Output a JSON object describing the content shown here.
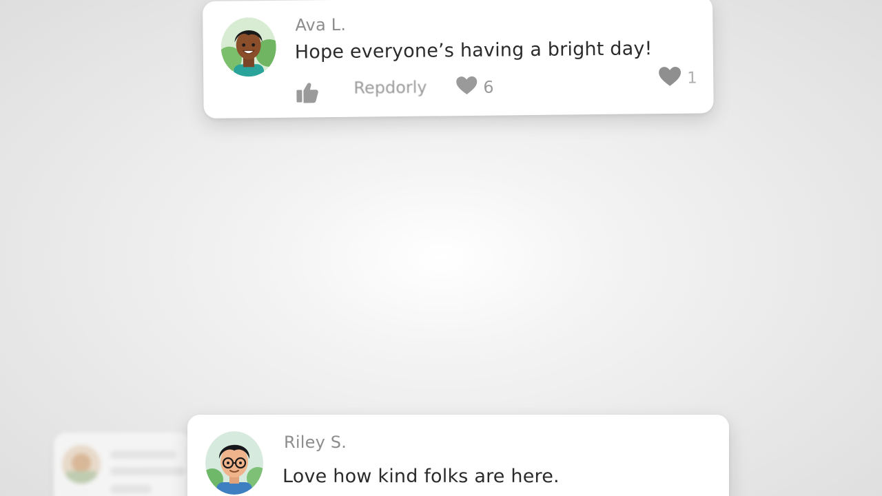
{
  "comments": [
    {
      "author": "Ava L.",
      "message": "Hope everyone’s having a bright day!",
      "reply_label": "Repdorly",
      "like_icon": "thumbs-up-icon",
      "heart_icon": "heart-icon",
      "heart_count": "6",
      "secondary_heart_count": "1",
      "avatar": "avatar-ava"
    },
    {
      "author": "Riley S.",
      "message": "Love how kind folks are here.",
      "avatar": "avatar-riley"
    }
  ],
  "colors": {
    "background": "#ececec",
    "card": "#ffffff",
    "author_text": "#8d8d8d",
    "message_text": "#2b2b2b",
    "action_icon": "#9a9a9a"
  }
}
